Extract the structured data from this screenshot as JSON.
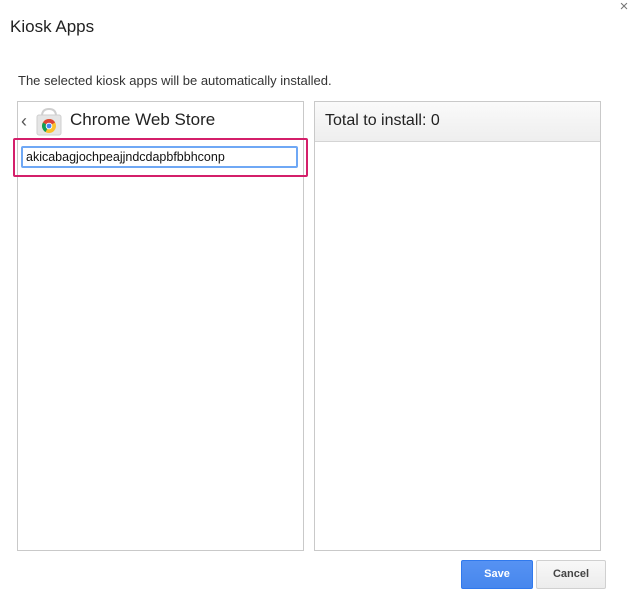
{
  "dialog": {
    "title": "Kiosk Apps",
    "close_glyph": "×",
    "description": "The selected kiosk apps will be automatically installed."
  },
  "left_panel": {
    "back_glyph": "‹",
    "logo_icon": "chrome-web-store-icon",
    "store_title": "Chrome Web Store",
    "search_value": "akicabagjochpeajjndcdapbfbbhconp"
  },
  "right_panel": {
    "total_label": "Total to install:",
    "total_count": "0"
  },
  "buttons": {
    "save_label": "Save",
    "cancel_label": "Cancel"
  },
  "colors": {
    "save_button": "#4787ed",
    "highlight_border": "#d41f6a",
    "input_focus_border": "#6fa8f5"
  }
}
